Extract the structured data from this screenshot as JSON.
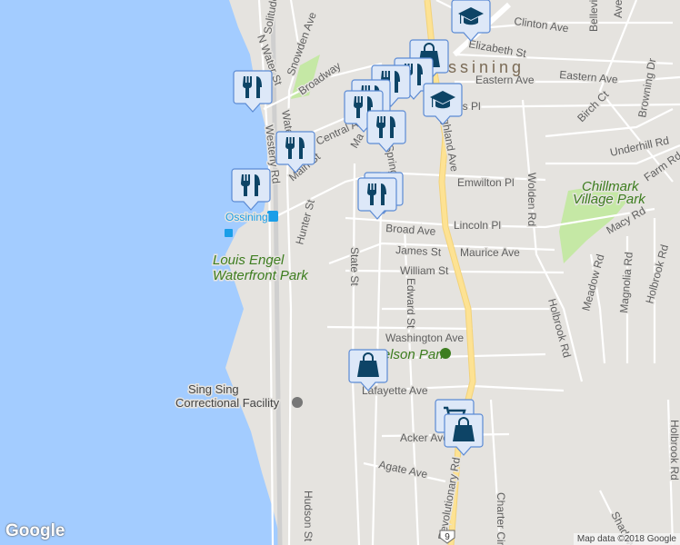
{
  "map": {
    "streets": {
      "clinton": "Clinton Ave",
      "elizabeth": "Elizabeth St",
      "eastern1": "Eastern Ave",
      "eastern2": "Eastern Ave",
      "bellevue": "Bellevie",
      "ave_top": "Ave",
      "birch": "Birch Ct",
      "browning": "Browning Dr",
      "underhill": "Underhill Rd",
      "farm": "Farm Rd",
      "macy": "Macy Rd",
      "emwilton": "Emwilton Pl",
      "wolden": "Wolden Rd",
      "lincoln": "Lincoln Pl",
      "broad": "Broad Ave",
      "james": "James St",
      "maurice": "Maurice Ave",
      "william": "William St",
      "state": "State St",
      "edward": "Edward St",
      "washington": "Washington Ave",
      "lafayette": "Lafayette Ave",
      "acker": "Acker Ave",
      "agate": "Agate Ave",
      "hudson": "Hudson St",
      "revolutionary": "Revolutionary Rd",
      "charter": "Charter Cir",
      "holbrook1": "Holbrook Rd",
      "holbrook2": "Holbrook Rd",
      "meadow": "Meadow Rd",
      "magnolia": "Magnolia Rd",
      "hunter": "Hunter St",
      "main": "Main St",
      "central": "Central Ave",
      "broadway": "Broadway",
      "snowden": "Snowden Ave",
      "nwater": "N Water St",
      "westerly": "Westerly Rd",
      "solitude": "Solitude",
      "water": "Water St",
      "spring": "Spring St",
      "highland": "Highland Ave",
      "ls_pl": "is Pl",
      "shadow": "Shadow Br",
      "ma": "Ma"
    },
    "town": "Ossining",
    "places": {
      "station": "Ossining",
      "waterfront_park": [
        "Louis Engel",
        "Waterfront Park"
      ],
      "chillmark": [
        "Chillmark",
        "Village Park"
      ],
      "nelson_park": "Nelson Park",
      "sing_sing": [
        "Sing Sing",
        "Correctional Facility"
      ]
    },
    "route_shield": "9",
    "attribution": "Map data ©2018 Google",
    "logo": "Google",
    "colors": {
      "water": "#a3ccff",
      "land": "#e5e3df",
      "highway": "#fde293",
      "marker_fill": "#dde8f8",
      "marker_icon": "#0d4466",
      "park": "#c5e8a5"
    },
    "markers": [
      {
        "type": "restaurant"
      },
      {
        "type": "restaurant"
      },
      {
        "type": "restaurant"
      },
      {
        "type": "restaurant"
      },
      {
        "type": "restaurant"
      },
      {
        "type": "restaurant"
      },
      {
        "type": "restaurant"
      },
      {
        "type": "restaurant"
      },
      {
        "type": "shopping"
      },
      {
        "type": "shopping"
      },
      {
        "type": "shopping"
      },
      {
        "type": "school"
      },
      {
        "type": "school"
      },
      {
        "type": "grocery"
      }
    ]
  }
}
